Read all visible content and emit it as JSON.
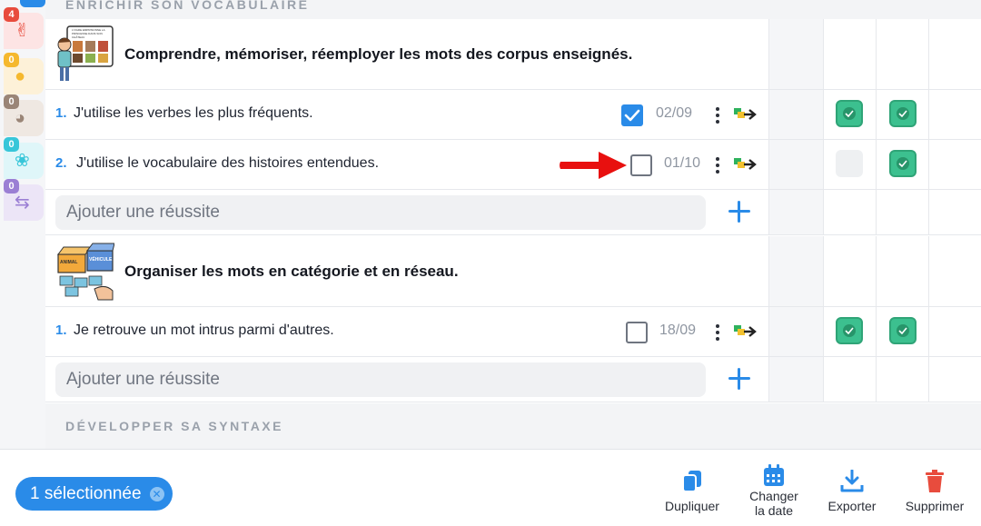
{
  "rail": {
    "items": [
      {
        "badge": "4",
        "badge_color": "#e84c3d",
        "bg": "#fde4e4",
        "icon": "hand-icon",
        "glyph": "✌"
      },
      {
        "badge": "0",
        "badge_color": "#f5b82e",
        "bg": "#fdf1d8",
        "icon": "ball-icon",
        "glyph": "●"
      },
      {
        "badge": "0",
        "badge_color": "#9a8577",
        "bg": "#efe8e2",
        "icon": "palette-icon",
        "glyph": "◕"
      },
      {
        "badge": "0",
        "badge_color": "#38c6d9",
        "bg": "#dff6f9",
        "icon": "paw-icon",
        "glyph": "❀"
      },
      {
        "badge": "0",
        "badge_color": "#9b7fd4",
        "bg": "#ece5f7",
        "icon": "handshake-icon",
        "glyph": "⇆"
      }
    ]
  },
  "sections": {
    "top_label": "ENRICHIR SON VOCABULAIRE",
    "bottom_label": "DÉVELOPPER SA SYNTAXE"
  },
  "goal1": {
    "title": "Comprendre, mémoriser, réemployer les mots des corpus enseignés.",
    "illustration": "child-reading-board-illustration",
    "board_text": "L'OGRE EMPRISONNE LA PRINCESSE DANS SON CHÂTEAU"
  },
  "goal1_rows": [
    {
      "num": "1.",
      "text": "J'utilise les verbes les plus fréquents.",
      "checked": true,
      "date": "02/09",
      "grid": [
        false,
        true,
        true
      ]
    },
    {
      "num": "2.",
      "text": "J'utilise le vocabulaire des histoires entendues.",
      "checked": false,
      "date": "01/10",
      "grid": [
        "empty",
        false,
        true
      ]
    }
  ],
  "goal2": {
    "title": "Organiser les mots en catégorie et en réseau.",
    "illustration": "sorting-boxes-illustration",
    "box_labels": [
      "ANIMAL",
      "VÉHICULE"
    ]
  },
  "goal2_rows": [
    {
      "num": "1.",
      "text": "Je retrouve un mot intrus parmi d'autres.",
      "checked": false,
      "date": "18/09",
      "grid": [
        false,
        true,
        true
      ]
    }
  ],
  "add_placeholder": "Ajouter une réussite",
  "toolbar": {
    "selection_label": "1 sélectionnée",
    "actions": [
      {
        "label": "Dupliquer",
        "icon": "duplicate-icon",
        "color": "#2a8be8"
      },
      {
        "label": "Changer la date",
        "icon": "calendar-icon",
        "color": "#2a8be8"
      },
      {
        "label": "Exporter",
        "icon": "download-icon",
        "color": "#2a8be8"
      },
      {
        "label": "Supprimer",
        "icon": "trash-icon",
        "color": "#e84c3d"
      }
    ]
  },
  "colors": {
    "accent": "#2a8be8",
    "success": "#3cc08f",
    "danger": "#e84c3d",
    "pointer_arrow": "#e8100f"
  }
}
